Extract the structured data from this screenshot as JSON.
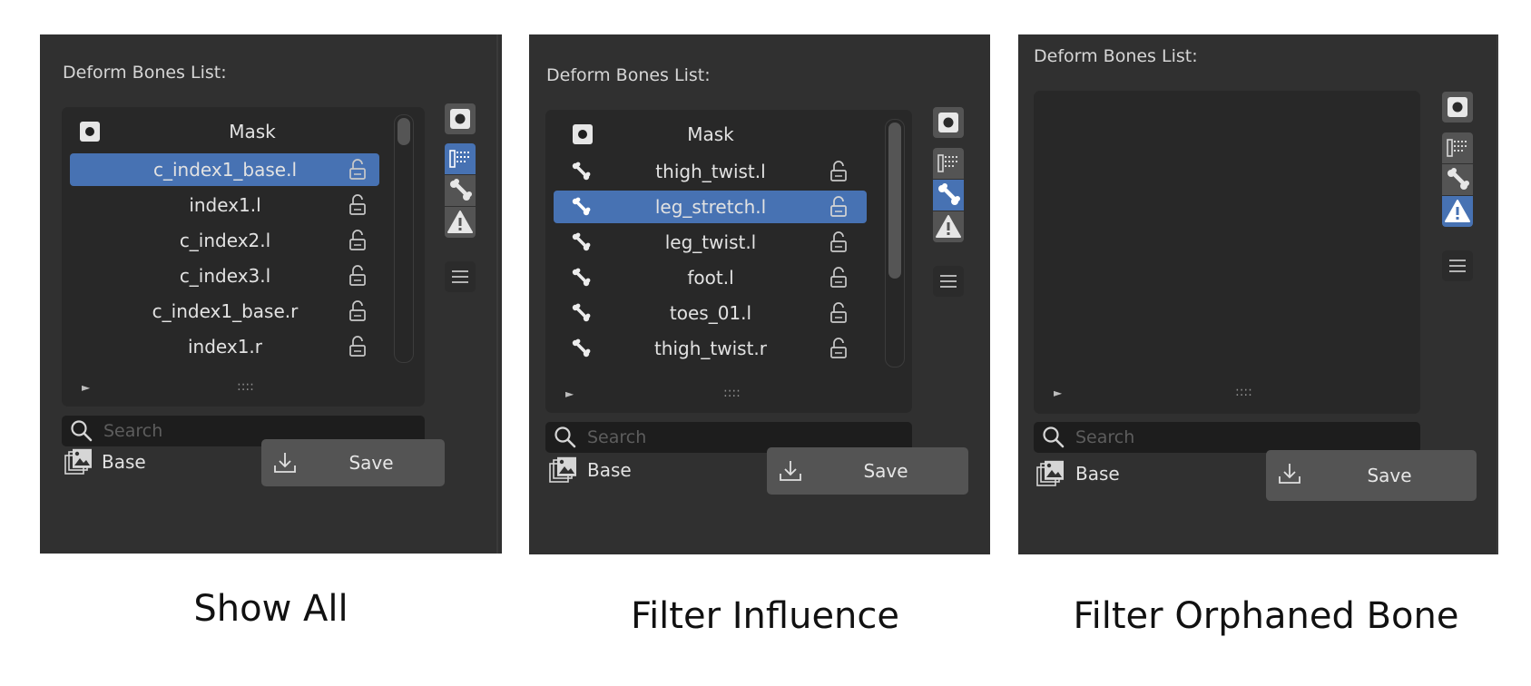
{
  "panels": [
    {
      "heading": "Deform Bones List:",
      "rows": [
        {
          "icon": "mask-icon",
          "label": "Mask",
          "lock": false,
          "selected": false
        },
        {
          "icon": "",
          "label": "c_index1_base.l",
          "lock": true,
          "selected": true
        },
        {
          "icon": "",
          "label": "index1.l",
          "lock": true,
          "selected": false
        },
        {
          "icon": "",
          "label": "c_index2.l",
          "lock": true,
          "selected": false
        },
        {
          "icon": "",
          "label": "c_index3.l",
          "lock": true,
          "selected": false
        },
        {
          "icon": "",
          "label": "c_index1_base.r",
          "lock": true,
          "selected": false
        },
        {
          "icon": "",
          "label": "index1.r",
          "lock": true,
          "selected": false
        }
      ],
      "scroll": {
        "visible": true,
        "thumb_fraction": 0.14
      },
      "active_filter": "show-all",
      "search_placeholder": "Search",
      "base_label": "Base",
      "save_label": "Save",
      "caption": "Show All"
    },
    {
      "heading": "Deform Bones List:",
      "rows": [
        {
          "icon": "mask-icon",
          "label": "Mask",
          "lock": false,
          "selected": false
        },
        {
          "icon": "bone-icon",
          "label": "thigh_twist.l",
          "lock": true,
          "selected": false
        },
        {
          "icon": "bone-icon",
          "label": "leg_stretch.l",
          "lock": true,
          "selected": true
        },
        {
          "icon": "bone-icon",
          "label": "leg_twist.l",
          "lock": true,
          "selected": false
        },
        {
          "icon": "bone-icon",
          "label": "foot.l",
          "lock": true,
          "selected": false
        },
        {
          "icon": "bone-icon",
          "label": "toes_01.l",
          "lock": true,
          "selected": false
        },
        {
          "icon": "bone-icon",
          "label": "thigh_twist.r",
          "lock": true,
          "selected": false
        }
      ],
      "scroll": {
        "visible": true,
        "thumb_fraction": 0.63
      },
      "active_filter": "influence",
      "search_placeholder": "Search",
      "base_label": "Base",
      "save_label": "Save",
      "caption": "Filter Influence"
    },
    {
      "heading": "Deform Bones List:",
      "rows": [],
      "scroll": {
        "visible": false,
        "thumb_fraction": 0
      },
      "active_filter": "orphaned",
      "search_placeholder": "Search",
      "base_label": "Base",
      "save_label": "Save",
      "caption": "Filter Orphaned Bone"
    }
  ],
  "colors": {
    "panel_bg": "#303030",
    "list_bg": "#282828",
    "selection": "#4772b3",
    "button": "#545454",
    "text": "#e2e2e2"
  },
  "icons": {
    "filters": [
      "mask-filter-icon",
      "show-all-list-icon",
      "bone-filter-icon",
      "warning-icon"
    ],
    "menu": "hamburger-menu-icon",
    "search": "search-icon",
    "lock": "unlocked-padlock-icon",
    "save": "download-arrow-icon",
    "base": "image-stack-icon",
    "expand": "disclosure-triangle-icon",
    "grip": "resize-grip-icon"
  }
}
